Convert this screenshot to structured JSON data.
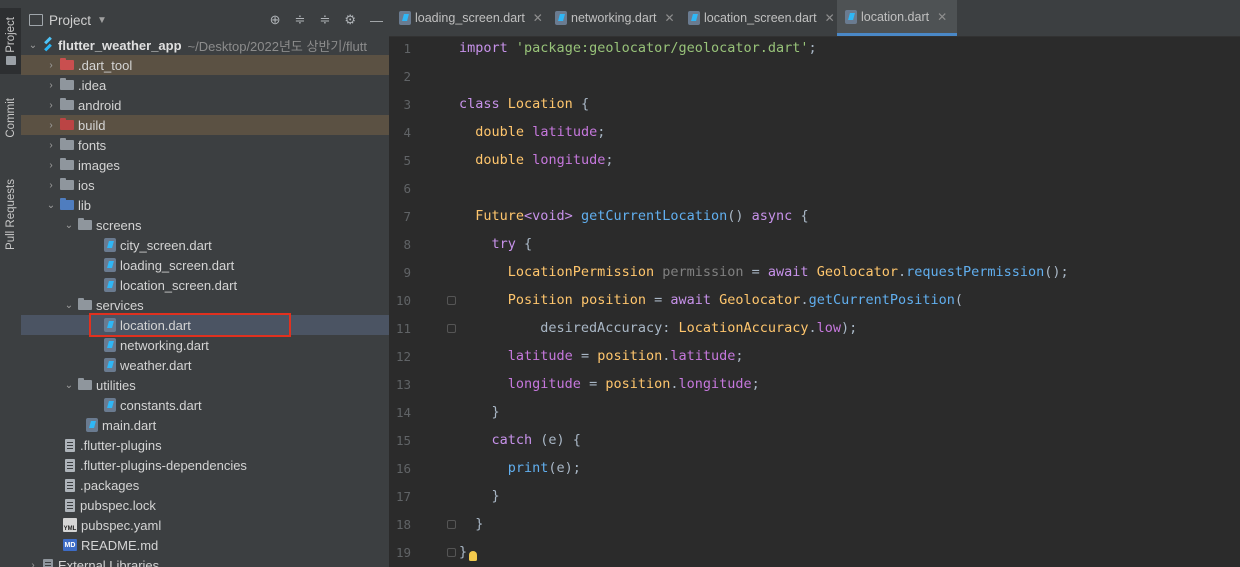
{
  "left_strip": {
    "project_label": "Project",
    "commit_label": "Commit",
    "pull_requests_label": "Pull Requests"
  },
  "panel": {
    "title": "Project",
    "tools": [
      "target-icon",
      "expand-icon",
      "collapse-icon",
      "gear-icon",
      "minimize-icon"
    ]
  },
  "tree": {
    "root_name": "flutter_weather_app",
    "root_path": "~/Desktop/2022년도 상반기/flutt",
    "items": [
      {
        "label": ".dart_tool"
      },
      {
        "label": ".idea"
      },
      {
        "label": "android"
      },
      {
        "label": "build"
      },
      {
        "label": "fonts"
      },
      {
        "label": "images"
      },
      {
        "label": "ios"
      },
      {
        "label": "lib"
      },
      {
        "label": "screens"
      },
      {
        "label": "city_screen.dart"
      },
      {
        "label": "loading_screen.dart"
      },
      {
        "label": "location_screen.dart"
      },
      {
        "label": "services"
      },
      {
        "label": "location.dart"
      },
      {
        "label": "networking.dart"
      },
      {
        "label": "weather.dart"
      },
      {
        "label": "utilities"
      },
      {
        "label": "constants.dart"
      },
      {
        "label": "main.dart"
      },
      {
        "label": ".flutter-plugins"
      },
      {
        "label": ".flutter-plugins-dependencies"
      },
      {
        "label": ".packages"
      },
      {
        "label": "pubspec.lock"
      },
      {
        "label": "pubspec.yaml"
      },
      {
        "label": "README.md"
      },
      {
        "label": "External Libraries"
      }
    ]
  },
  "tabs": [
    {
      "label": "loading_screen.dart"
    },
    {
      "label": "networking.dart"
    },
    {
      "label": "location_screen.dart"
    },
    {
      "label": "location.dart"
    }
  ],
  "active_tab": "location.dart",
  "code": {
    "line_numbers": [
      "1",
      "2",
      "3",
      "4",
      "5",
      "6",
      "7",
      "8",
      "9",
      "10",
      "11",
      "12",
      "13",
      "14",
      "15",
      "16",
      "17",
      "18",
      "19"
    ],
    "l1_kw": "import",
    "l1_str": "'package:geolocator/geolocator.dart'",
    "l1_end": ";",
    "l3_kw": "class",
    "l3_name": "Location",
    "l3_end": " {",
    "l4_type": "double",
    "l4_field": "latitude",
    "l5_type": "double",
    "l5_field": "longitude",
    "l7_type": "Future",
    "l7_generic": "<void>",
    "l7_fn": "getCurrentLocation",
    "l7_rest": "() ",
    "l7_async": "async",
    "l8_kw": "try",
    "l9_type": "LocationPermission",
    "l9_var": "permission",
    "l9_await": "await",
    "l9_cls": "Geolocator",
    "l9_fn": "requestPermission",
    "l10_type": "Position",
    "l10_var": "position",
    "l10_await": "await",
    "l10_cls": "Geolocator",
    "l10_fn": "getCurrentPosition",
    "l11_param": "desiredAccuracy:",
    "l11_cls": "LocationAccuracy",
    "l11_val": "low",
    "l12_field": "latitude",
    "l12_obj": "position",
    "l12_prop": "latitude",
    "l13_field": "longitude",
    "l13_obj": "position",
    "l13_prop": "longitude",
    "l15_kw": "catch",
    "l15_rest": " (e) {",
    "l16_fn": "print",
    "l16_rest": "(e);"
  }
}
